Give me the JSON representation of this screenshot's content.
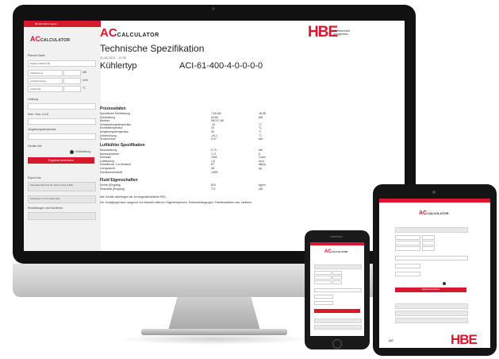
{
  "app": {
    "logo_ac": "AC",
    "logo_text": "CALCULATOR",
    "brand": "HBE",
    "brand_sub_1": "Kaeltetechnik",
    "brand_sub_2": "Anlagenbau"
  },
  "sidebar": {
    "topbar_text": "DE  EN  Menü  Logout",
    "fields": [
      {
        "label": "Planner Sales",
        "value": "Medium R407C 6K"
      },
      {
        "label": "",
        "value": "Kühlleistung",
        "unit": "kW"
      },
      {
        "label": "",
        "value": "Austrittsmenge",
        "unit": "m³/h"
      },
      {
        "label": "",
        "value": "Lufteintritt",
        "unit": "°C"
      }
    ],
    "section_labels": [
      "Leistung",
      "Kühl. Gew. LLVK",
      "Umgebungstemperatur",
      "Geräte-Info"
    ],
    "checkbox_label": "Kühlleistung",
    "calc_button": "Ergebnis berechnen",
    "export_label": "Export Info",
    "export_values": [
      "Standard R32 ACI-61-400-4-0-0-0-0 800",
      "Kühlsystem mit F.Kältemittel"
    ],
    "extra_label": "Einstellungen und Kundennr."
  },
  "document": {
    "title": "Technische Spezifikation",
    "date": "11.08.2021 - 11:30",
    "type_label": "Kühlertyp",
    "type_code": "ACI-61-400-4-0-0-0-0",
    "section1": "Prozessdaten",
    "rows1": [
      [
        "Spezifische Kühlleistung",
        "7,59 kW",
        "18,35"
      ],
      [
        "Kühlleistung",
        "44,89",
        "kW"
      ],
      [
        "Medium",
        "R407C 6K",
        ""
      ],
      [
        "Verdampfungstemperatur",
        "-10",
        "°C"
      ],
      [
        "Eintrittstemperatur",
        "40",
        "°C"
      ],
      [
        "Umgebungstemperatur",
        "30",
        "°C"
      ],
      [
        "Unterkühlung",
        "-40,1",
        "°C"
      ],
      [
        "Druckverlust",
        "0,47",
        "bar"
      ]
    ],
    "section2": "Luftkühler Spezifikation",
    "rows2": [
      [
        "Motorleistung",
        "0,70",
        "kW"
      ],
      [
        "Nennaufnahme",
        "1,71",
        "A"
      ],
      [
        "Drehzahl",
        "1350",
        "1/min"
      ],
      [
        "Luftleistung",
        "1,6",
        "m³/s"
      ],
      [
        "Schalldruck 1 m Abstand",
        "67",
        "dB(A)"
      ],
      [
        "Leergewicht",
        "48",
        "kg"
      ],
      [
        "Gehäusewerkstoff",
        "1/800",
        ""
      ]
    ],
    "section3": "Fluid Eigenschaften",
    "rows3": [
      [
        "Dichte (Eingang)",
        "810",
        "kg/m³"
      ],
      [
        "Viskosität (Eingang)",
        "717",
        "cSt"
      ]
    ],
    "footer1": "Alle Geräte unterliegen der Druckgeräterichtlinie PED.",
    "footer2": "Der Schallpegel kann aufgrund von Bauart/Luftstrom, Eigenfrequenzen, Einbaubedingungen, Fabrikbauteilen usw. variieren."
  },
  "mobile": {
    "logo_ac": "AC",
    "logo_text": "CALCULATOR",
    "calc_button": "Ergebnis berechnen",
    "brand": "HBE"
  }
}
